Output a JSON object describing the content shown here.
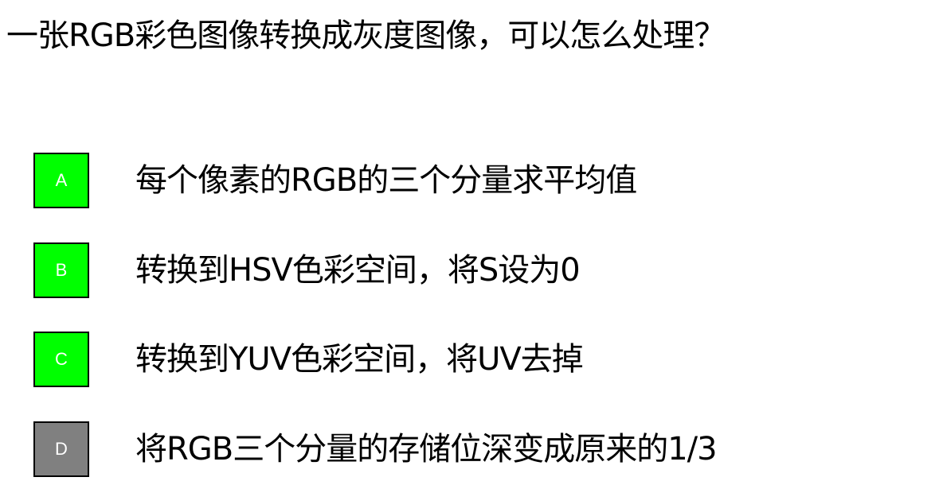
{
  "question": "一张RGB彩色图像转换成灰度图像，可以怎么处理？",
  "options": [
    {
      "letter": "A",
      "text": "每个像素的RGB的三个分量求平均值",
      "badge_color": "#00ff00"
    },
    {
      "letter": "B",
      "text": "转换到HSV色彩空间，将S设为0",
      "badge_color": "#00ff00"
    },
    {
      "letter": "C",
      "text": "转换到YUV色彩空间，将UV去掉",
      "badge_color": "#00ff00"
    },
    {
      "letter": "D",
      "text": "将RGB三个分量的存储位深变成原来的1/3",
      "badge_color": "#808080"
    }
  ]
}
